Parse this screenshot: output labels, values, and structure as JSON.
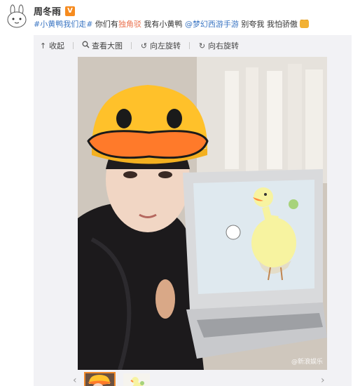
{
  "post": {
    "author": "周冬雨",
    "verified_badge": "V",
    "topic": "#小黄鸭我们走#",
    "text_part1": " 你们有",
    "highlight": "独角驳",
    "text_part2": " 我有小黄鸭 ",
    "mention": "@梦幻西游手游",
    "text_part3": " 别夸我 我怕骄傲"
  },
  "toolbar": {
    "collapse_label": "收起",
    "view_large_label": "查看大图",
    "rotate_left_label": "向左旋转",
    "rotate_right_label": "向右旋转"
  },
  "photo": {
    "watermark": "@新浪娱乐"
  },
  "icons": {
    "collapse": "collapse-up-arrow-icon",
    "view_large": "magnifier-icon",
    "rotate_left": "rotate-left-icon",
    "rotate_right": "rotate-right-icon",
    "verified": "verified-v-icon"
  },
  "colors": {
    "link": "#3b76c3",
    "highlight": "#eb7350",
    "badge": "#f68b1f",
    "thumb_border": "#f08a2c"
  }
}
